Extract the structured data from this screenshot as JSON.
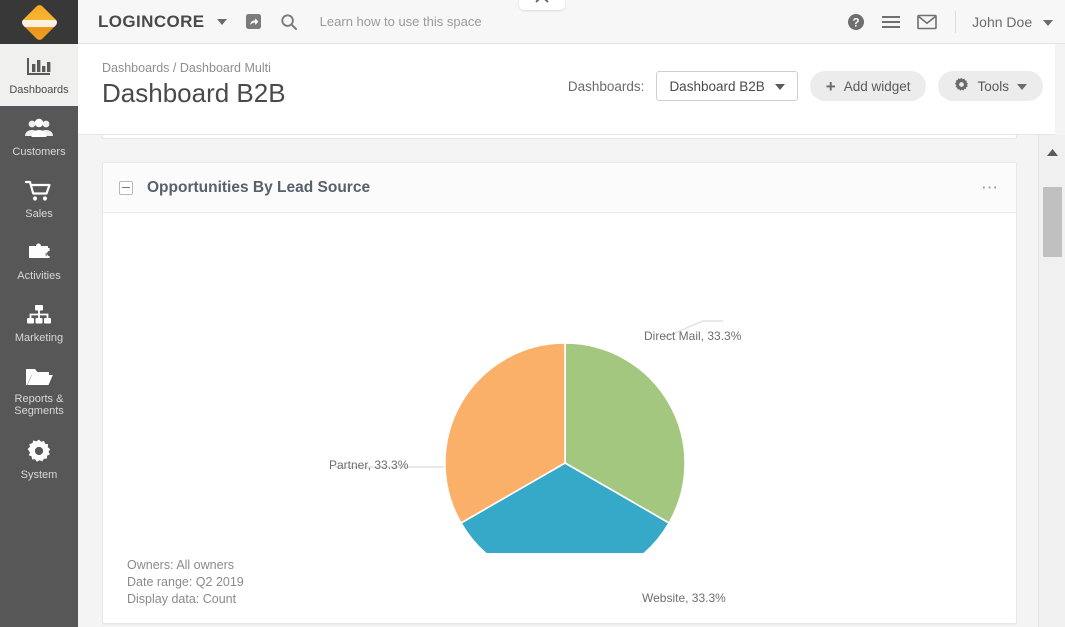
{
  "rail": {
    "logo_icon": "diamond-logo",
    "items": [
      {
        "label": "Dashboards",
        "icon": "bar-chart-icon",
        "active": true
      },
      {
        "label": "Customers",
        "icon": "people-icon",
        "active": false
      },
      {
        "label": "Sales",
        "icon": "shopping-cart-icon",
        "active": false
      },
      {
        "label": "Activities",
        "icon": "puzzle-piece-icon",
        "active": false
      },
      {
        "label": "Marketing",
        "icon": "sitemap-icon",
        "active": false
      },
      {
        "label": "Reports & Segments",
        "icon": "folder-open-icon",
        "active": false
      },
      {
        "label": "System",
        "icon": "gear-icon",
        "active": false
      }
    ]
  },
  "topbar": {
    "brand": "LOGINCORE",
    "brand_caret_icon": "chevron-down-icon",
    "shortcut_icon": "external-link-icon",
    "search_icon": "search-icon",
    "hint": "Learn how to use this space",
    "help_icon": "help-circle-icon",
    "menu_icon": "hamburger-menu-icon",
    "mail_icon": "envelope-icon",
    "user": "John Doe",
    "user_caret_icon": "chevron-down-icon",
    "pulltab_icon": "chevron-up-icon"
  },
  "page": {
    "breadcrumb_root": "Dashboards",
    "breadcrumb_sep": " / ",
    "breadcrumb_current": "Dashboard Multi",
    "title": "Dashboard B2B"
  },
  "toolbar": {
    "dashboards_label": "Dashboards:",
    "dashboard_selected": "Dashboard B2B",
    "select_caret_icon": "chevron-down-icon",
    "add_widget_label": "Add widget",
    "add_widget_icon": "plus-icon",
    "tools_label": "Tools",
    "tools_icon": "gear-icon",
    "tools_caret_icon": "chevron-down-icon"
  },
  "widget": {
    "title": "Opportunities By Lead Source",
    "collapse_icon": "collapse-minus-icon",
    "menu_icon": "ellipsis-icon",
    "meta": {
      "owners": "Owners: All owners",
      "date_range": "Date range: Q2 2019",
      "display_data": "Display data: Count"
    }
  },
  "chart_data": {
    "type": "pie",
    "title": "Opportunities By Lead Source",
    "categories": [
      "Direct Mail",
      "Website",
      "Partner"
    ],
    "values": [
      33.3,
      33.3,
      33.3
    ],
    "unit": "%",
    "labels": [
      "Direct Mail, 33.3%",
      "Website, 33.3%",
      "Partner, 33.3%"
    ],
    "colors": [
      "#a3c77f",
      "#36a9c9",
      "#fbb06a"
    ],
    "legend": "none",
    "grid": false,
    "display_data": "Count",
    "date_range": "Q2 2019",
    "owners": "All owners"
  },
  "scrollbar": {
    "up_arrow_icon": "scroll-up-arrow-icon",
    "thumb_name": "scroll-thumb"
  }
}
